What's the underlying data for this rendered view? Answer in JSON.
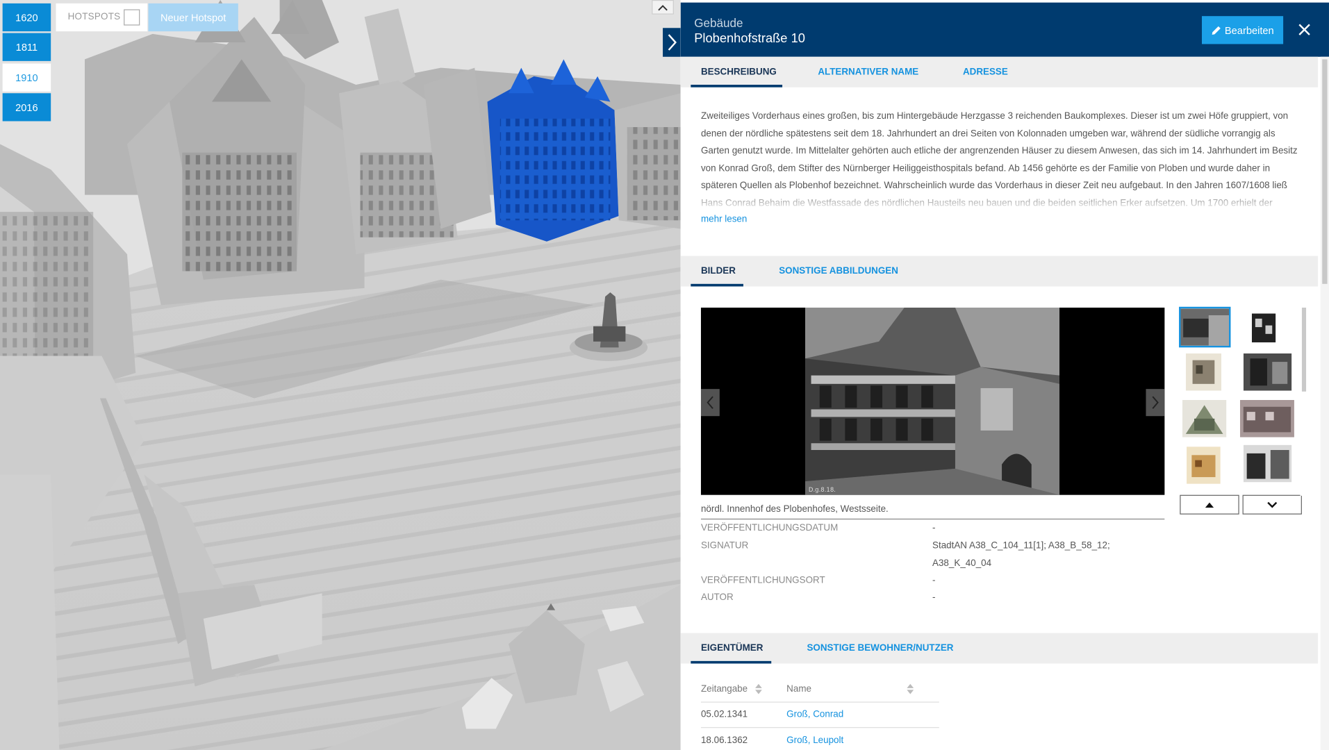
{
  "timeline": {
    "years": [
      "1620",
      "1811",
      "1910",
      "2016"
    ],
    "active_year": "1910"
  },
  "hotspots": {
    "label": "HOTSPOTS",
    "checked": false,
    "new_button": "Neuer Hotspot"
  },
  "colors": {
    "header_bg": "#003b6f",
    "accent": "#1592df",
    "year_button": "#0a8bd6",
    "highlight_building": "#1756c8"
  },
  "panel": {
    "type_label": "Gebäude",
    "title": "Plobenhofstraße 10",
    "edit_button": "Bearbeiten",
    "close_icon": "close-icon",
    "info_tabs": [
      "BESCHREIBUNG",
      "ALTERNATIVER NAME",
      "ADRESSE"
    ],
    "description": "Zweiteiliges Vorderhaus eines großen, bis zum Hintergebäude Herzgasse 3 reichenden Baukomplexes. Dieser ist um zwei Höfe gruppiert, von denen der nördliche spätestens seit dem 18. Jahrhundert an drei Seiten von Kolonnaden umgeben war, während der südliche vorrangig als Garten genutzt wurde. Im Mittelalter gehörten auch etliche der angrenzenden Häuser zu diesem Anwesen, das sich im 14. Jahrhundert im Besitz von Konrad Groß, dem Stifter des Nürnberger Heiliggeisthospitals befand. Ab 1456 gehörte es der Familie von Ploben und wurde daher in späteren Quellen als Plobenhof bezeichnet. Wahrscheinlich wurde das Vorderhaus in dieser Zeit neu aufgebaut. In den Jahren 1607/1608 ließ Hans Conrad Behaim die Westfassade des nördlichen Hausteils neu bauen und die beiden seitlichen Erker aufsetzen. Um 1700 erhielt der",
    "more_link": "mehr lesen",
    "image_tabs": [
      "BILDER",
      "SONSTIGE ABBILDUNGEN"
    ],
    "image_caption": "nördl. Innenhof des Plobenhofes, Westsseite.",
    "image_stamp": "D.g.8.18.",
    "metadata": [
      {
        "key": "VERÖFFENTLICHUNGSDATUM",
        "value": "-"
      },
      {
        "key": "SIGNATUR",
        "value": "StadtAN A38_C_104_11[1]; A38_B_58_12; A38_K_40_04"
      },
      {
        "key": "VERÖFFENTLICHUNGSORT",
        "value": "-"
      },
      {
        "key": "AUTOR",
        "value": "-"
      }
    ],
    "owner_tabs": [
      "EIGENTÜMER",
      "SONSTIGE BEWOHNER/NUTZER"
    ],
    "owner_columns": [
      "Zeitangabe",
      "Name"
    ],
    "owners": [
      {
        "date": "05.02.1341",
        "name": "Groß, Conrad"
      },
      {
        "date": "18.06.1362",
        "name": "Groß, Leupolt"
      }
    ]
  }
}
